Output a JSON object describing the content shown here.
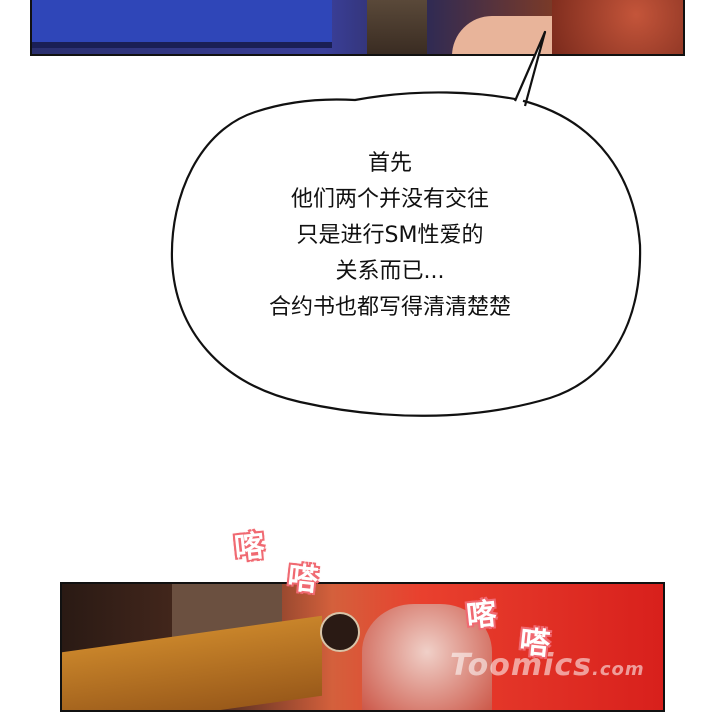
{
  "speech_bubble": {
    "lines": [
      "首先",
      "他们两个并没有交往",
      "只是进行SM性爱的",
      "关系而已...",
      "合约书也都写得清清楚楚"
    ]
  },
  "sound_effects": [
    "喀",
    "嗒",
    "喀",
    "嗒"
  ],
  "watermark": {
    "text": "Toomics",
    "suffix": ".com"
  }
}
